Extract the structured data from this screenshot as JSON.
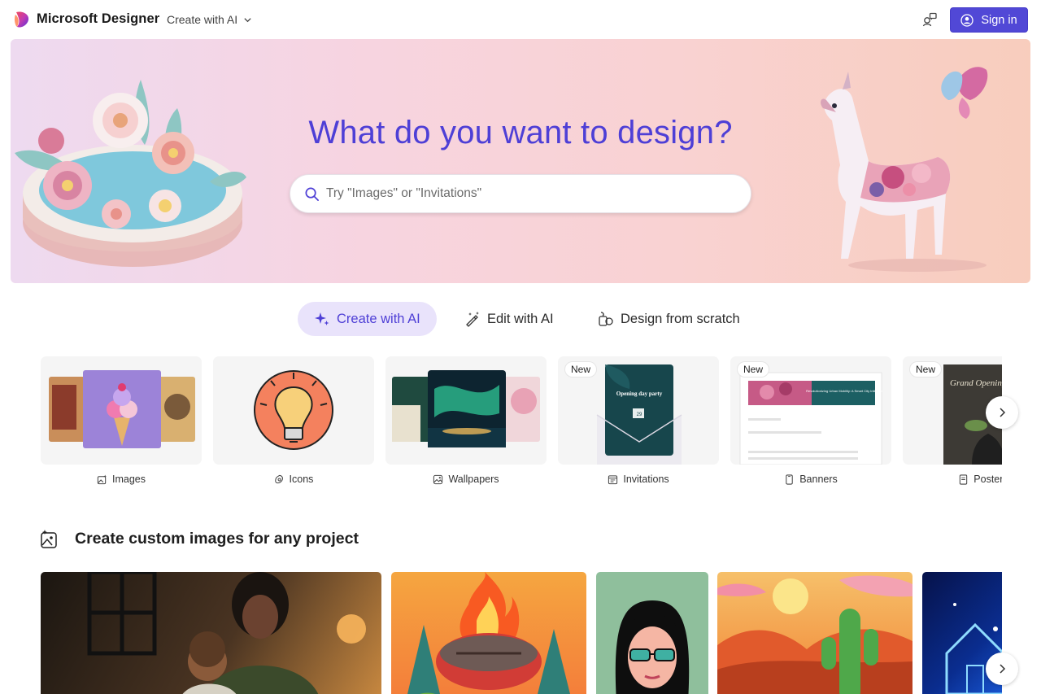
{
  "header": {
    "brand": "Microsoft Designer",
    "mode_dropdown": "Create with AI",
    "signin_label": "Sign in"
  },
  "hero": {
    "title": "What do you want to design?",
    "search_placeholder": "Try \"Images\" or \"Invitations\""
  },
  "tabs": [
    {
      "label": "Create with AI",
      "icon": "sparkle-icon",
      "active": true
    },
    {
      "label": "Edit with AI",
      "icon": "magic-wand-icon",
      "active": false
    },
    {
      "label": "Design from scratch",
      "icon": "shapes-icon",
      "active": false
    }
  ],
  "categories": [
    {
      "label": "Images",
      "icon": "image-sparkle-icon",
      "badge": ""
    },
    {
      "label": "Icons",
      "icon": "shape-icon",
      "badge": ""
    },
    {
      "label": "Wallpapers",
      "icon": "wallpaper-icon",
      "badge": ""
    },
    {
      "label": "Invitations",
      "icon": "calendar-icon",
      "badge": "New",
      "thumb_title": "Opening day party",
      "thumb_date": "29"
    },
    {
      "label": "Banners",
      "icon": "phone-icon",
      "badge": "New",
      "thumb_title": "Revolutionizing Urban Mobility: A Smart City Initiative"
    },
    {
      "label": "Posters",
      "icon": "document-icon",
      "badge": "New",
      "thumb_title": "Grand Opening"
    }
  ],
  "section": {
    "title": "Create custom images for any project",
    "icon": "image-sparkle-icon"
  },
  "colors": {
    "accent": "#5148d6",
    "title": "#4e3fd6",
    "active_tab_bg": "#e9e3fb"
  }
}
